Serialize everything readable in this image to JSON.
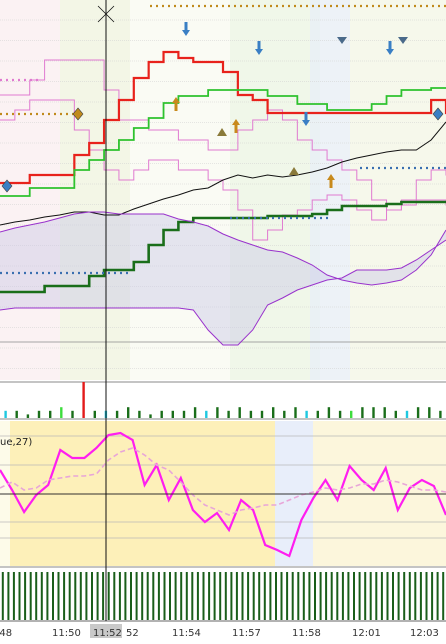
{
  "indicator_label": "ue,27)",
  "chart_data": [
    {
      "type": "line",
      "panel": "main",
      "grid": true,
      "series": [
        {
          "color": "#e8221c",
          "values": [
            183,
            183,
            175,
            175,
            175,
            155,
            143,
            120,
            100,
            78,
            62,
            52,
            58,
            62,
            62,
            72,
            95,
            100,
            113,
            113,
            113,
            113,
            113,
            113,
            113,
            113,
            113,
            113,
            113,
            100,
            113
          ]
        },
        {
          "color": "#2ec22e",
          "values": [
            196,
            196,
            188,
            188,
            188,
            170,
            160,
            150,
            140,
            128,
            118,
            103,
            96,
            96,
            90,
            90,
            90,
            90,
            96,
            96,
            104,
            104,
            110,
            110,
            110,
            104,
            96,
            90,
            90,
            88,
            88
          ]
        },
        {
          "color": "#1a6e1a",
          "values": [
            292,
            292,
            292,
            286,
            286,
            286,
            276,
            270,
            270,
            262,
            245,
            230,
            222,
            218,
            218,
            218,
            218,
            218,
            216,
            216,
            216,
            214,
            210,
            206,
            206,
            206,
            204,
            202,
            202,
            202,
            202
          ]
        },
        {
          "color": "#111111",
          "values": [
            225,
            222,
            220,
            217,
            215,
            212,
            212,
            215,
            215,
            209,
            204,
            199,
            195,
            190,
            188,
            180,
            175,
            178,
            175,
            177,
            175,
            172,
            168,
            162,
            158,
            155,
            152,
            150,
            150,
            140,
            122
          ]
        },
        {
          "color": "#9932cc",
          "values": [
            232,
            228,
            225,
            222,
            218,
            214,
            212,
            212,
            214,
            214,
            214,
            214,
            219,
            222,
            226,
            234,
            240,
            245,
            250,
            252,
            258,
            265,
            275,
            280,
            283,
            285,
            283,
            280,
            270,
            255,
            230
          ]
        },
        {
          "color": "#9932cc",
          "values": [
            310,
            308,
            308,
            308,
            308,
            308,
            308,
            308,
            308,
            308,
            308,
            308,
            308,
            310,
            330,
            345,
            345,
            330,
            305,
            298,
            290,
            285,
            280,
            278,
            270,
            270,
            270,
            268,
            260,
            250,
            240
          ]
        }
      ]
    },
    {
      "type": "bar",
      "panel": "volume",
      "values": [
        2,
        2,
        1,
        2,
        2,
        3,
        2,
        10,
        2,
        2,
        2,
        3,
        2,
        1,
        2,
        2,
        2,
        3,
        2,
        3,
        2,
        3,
        2,
        2,
        3,
        2,
        3,
        2,
        2,
        3,
        2,
        2,
        3,
        3,
        3,
        2,
        2,
        3,
        3,
        2
      ]
    },
    {
      "type": "line",
      "panel": "oscillator",
      "legend": "ue,27)",
      "series": [
        {
          "color": "#ff1ef0",
          "values": [
            470,
            490,
            512,
            495,
            485,
            450,
            458,
            458,
            448,
            435,
            433,
            440,
            485,
            465,
            500,
            478,
            510,
            522,
            513,
            530,
            500,
            510,
            545,
            550,
            556,
            520,
            498,
            480,
            500,
            466,
            480,
            490,
            468,
            510,
            488,
            480,
            486,
            515
          ]
        },
        {
          "color": "#e8a6d8",
          "values": [
            488,
            482,
            490,
            488,
            480,
            478,
            476,
            476,
            474,
            460,
            452,
            448,
            455,
            465,
            470,
            482,
            495,
            505,
            510,
            515,
            510,
            508,
            505,
            505,
            500,
            495,
            492,
            488,
            490,
            488,
            484,
            484,
            480,
            482,
            486,
            490,
            490,
            492
          ]
        }
      ]
    },
    {
      "type": "bar",
      "panel": "bottom",
      "values": [
        1,
        1,
        1,
        1,
        1,
        1,
        1,
        1,
        1,
        1,
        1,
        1,
        1,
        1,
        1,
        1,
        1,
        1,
        1,
        1,
        1,
        1,
        1,
        1,
        1,
        1,
        1,
        1,
        1,
        1,
        1,
        1,
        1,
        1,
        1,
        1,
        1,
        1,
        1,
        1,
        1,
        1,
        1,
        1,
        1,
        1,
        1,
        1,
        1,
        1,
        1,
        1,
        1,
        1,
        1,
        1,
        1,
        1,
        1,
        1,
        1,
        1,
        1,
        1,
        1,
        1,
        1,
        1,
        1,
        1,
        1,
        1,
        1,
        1,
        1,
        1,
        1,
        1,
        1,
        1
      ]
    }
  ],
  "xaxis": {
    "labels": [
      ":48",
      "11:50",
      "11:52",
      "52",
      "11:54",
      "11:57",
      "11:58",
      "12:01",
      "12:03"
    ],
    "highlighted_index": 2
  }
}
